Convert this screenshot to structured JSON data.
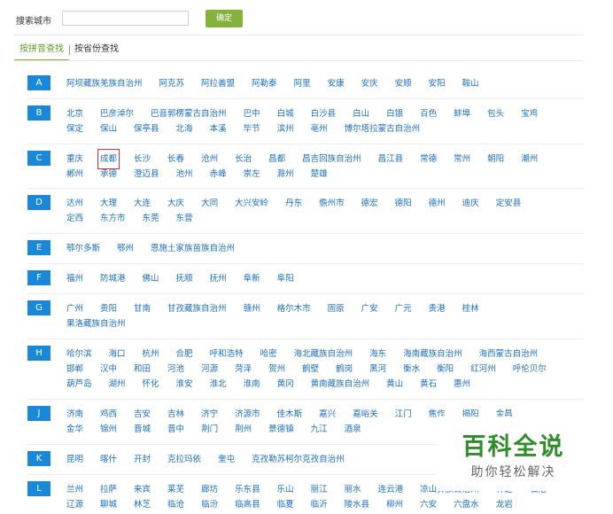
{
  "search": {
    "label": "搜索城市",
    "placeholder": "",
    "value": "",
    "confirm_label": "确定"
  },
  "tabs": {
    "active": "按拼音查找",
    "inactive": "按省份查找"
  },
  "colors": {
    "accent_green": "#86b23b",
    "letter_blue": "#1a88d8",
    "link_blue": "#1b6ec5",
    "highlight_red": "#e03030"
  },
  "selected_city": "成都",
  "groups": [
    {
      "letter": "A",
      "rows": [
        [
          "阿坝藏族羌族自治州",
          "阿克苏",
          "阿拉善盟",
          "阿勒泰",
          "阿里",
          "安康",
          "安庆",
          "安顺",
          "安阳",
          "鞍山"
        ]
      ]
    },
    {
      "letter": "B",
      "rows": [
        [
          "北京",
          "巴彦淖尔",
          "巴音郭楞蒙古自治州",
          "巴中",
          "白城",
          "白沙县",
          "白山",
          "白银",
          "百色",
          "蚌埠",
          "包头",
          "宝鸡"
        ],
        [
          "保定",
          "保山",
          "保亭县",
          "北海",
          "本溪",
          "毕节",
          "滨州",
          "亳州",
          "博尔塔拉蒙古自治州"
        ]
      ]
    },
    {
      "letter": "C",
      "rows": [
        [
          "重庆",
          "成都",
          "长沙",
          "长春",
          "沧州",
          "长治",
          "昌都",
          "昌吉回族自治州",
          "昌江县",
          "常德",
          "常州",
          "朝阳",
          "潮州"
        ],
        [
          "郴州",
          "承德",
          "澄迈县",
          "池州",
          "赤峰",
          "崇左",
          "滁州",
          "楚雄"
        ]
      ]
    },
    {
      "letter": "D",
      "rows": [
        [
          "达州",
          "大理",
          "大连",
          "大庆",
          "大同",
          "大兴安岭",
          "丹东",
          "儋州市",
          "德宏",
          "德阳",
          "德州",
          "迪庆",
          "定安县"
        ],
        [
          "定西",
          "东方市",
          "东莞",
          "东营"
        ]
      ]
    },
    {
      "letter": "E",
      "rows": [
        [
          "鄂尔多斯",
          "鄂州",
          "恩施土家族苗族自治州"
        ]
      ]
    },
    {
      "letter": "F",
      "rows": [
        [
          "福州",
          "防城港",
          "佛山",
          "抚顺",
          "抚州",
          "阜新",
          "阜阳"
        ]
      ]
    },
    {
      "letter": "G",
      "rows": [
        [
          "广州",
          "贵阳",
          "甘南",
          "甘孜藏族自治州",
          "赣州",
          "格尔木市",
          "固原",
          "广安",
          "广元",
          "贵港",
          "桂林"
        ],
        [
          "果洛藏族自治州"
        ]
      ]
    },
    {
      "letter": "H",
      "rows": [
        [
          "哈尔滨",
          "海口",
          "杭州",
          "合肥",
          "呼和浩特",
          "哈密",
          "海北藏族自治州",
          "海东",
          "海南藏族自治州",
          "海西蒙古自治州"
        ],
        [
          "邯郸",
          "汉中",
          "和田",
          "河池",
          "河源",
          "菏泽",
          "贺州",
          "鹤壁",
          "鹤岗",
          "黑河",
          "衡水",
          "衡阳",
          "红河州",
          "呼伦贝尔"
        ],
        [
          "葫芦岛",
          "湖州",
          "怀化",
          "淮安",
          "淮北",
          "淮南",
          "黄冈",
          "黄南藏族自治州",
          "黄山",
          "黄石",
          "惠州"
        ]
      ]
    },
    {
      "letter": "J",
      "rows": [
        [
          "济南",
          "鸡西",
          "吉安",
          "吉林",
          "济宁",
          "济源市",
          "佳木斯",
          "嘉兴",
          "嘉峪关",
          "江门",
          "焦作",
          "揭阳",
          "金昌"
        ],
        [
          "金华",
          "锦州",
          "晋城",
          "晋中",
          "荆门",
          "荆州",
          "景德镇",
          "九江",
          "酒泉"
        ]
      ]
    },
    {
      "letter": "K",
      "rows": [
        [
          "昆明",
          "喀什",
          "开封",
          "克拉玛依",
          "奎屯",
          "克孜勒苏柯尔克孜自治州"
        ]
      ]
    },
    {
      "letter": "L",
      "rows": [
        [
          "兰州",
          "拉萨",
          "来宾",
          "莱芜",
          "廊坊",
          "乐东县",
          "乐山",
          "丽江",
          "丽水",
          "连云港",
          "凉山彝族自治州",
          "林芝",
          "临沧"
        ],
        [
          "辽源",
          "聊城",
          "林芝",
          "临沧",
          "临汾",
          "临高县",
          "临夏",
          "临沂",
          "陵水县",
          "柳州",
          "六安",
          "六盘水",
          "龙岩"
        ]
      ]
    }
  ],
  "watermark": {
    "logo": "百科全说",
    "slogan": "助你轻松解决"
  }
}
